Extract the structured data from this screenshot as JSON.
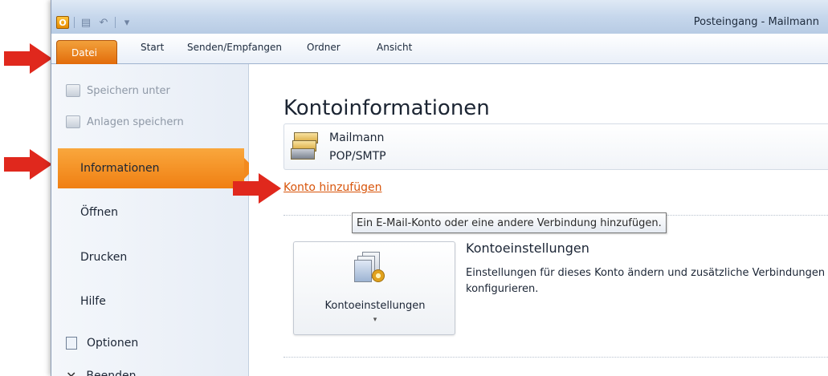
{
  "titlebar": {
    "title": "Posteingang - Mailmann",
    "app_icon_letter": "O"
  },
  "tabs": {
    "file": "Datei",
    "start": "Start",
    "send_receive": "Senden/Empfangen",
    "folder": "Ordner",
    "view": "Ansicht"
  },
  "nav": {
    "save_as": "Speichern unter",
    "save_attachments": "Anlagen speichern",
    "info": "Informationen",
    "open": "Öffnen",
    "print": "Drucken",
    "help": "Hilfe",
    "options": "Optionen",
    "exit": "Beenden"
  },
  "main": {
    "heading": "Kontoinformationen",
    "account_name": "Mailmann",
    "account_type": "POP/SMTP",
    "add_account_link": "Konto hinzufügen",
    "tooltip": "Ein E-Mail-Konto oder eine andere Verbindung hinzufügen.",
    "settings_button_label": "Kontoeinstellungen",
    "settings_title": "Kontoeinstellungen",
    "settings_description": "Einstellungen für dieses Konto ändern und zusätzliche Verbindungen konfigurieren."
  },
  "colors": {
    "accent_orange": "#f07f12",
    "arrow_red": "#e0281d",
    "link_orange": "#d8550b"
  },
  "icons": {
    "save_as": "save-as-icon",
    "save_attachments": "attachment-icon",
    "options": "options-icon",
    "exit": "close-icon",
    "account": "mailbox-icon",
    "settings": "account-settings-icon"
  }
}
